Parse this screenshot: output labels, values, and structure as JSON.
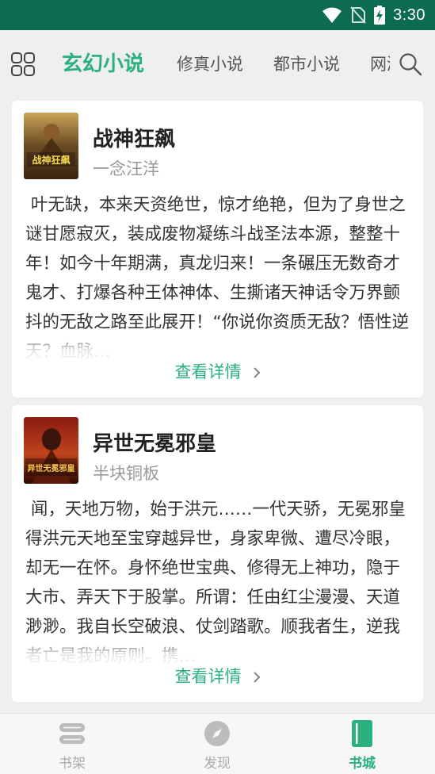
{
  "status": {
    "time": "3:30"
  },
  "nav": {
    "tabs": [
      {
        "label": "玄幻小说",
        "active": true
      },
      {
        "label": "修真小说",
        "active": false
      },
      {
        "label": "都市小说",
        "active": false
      },
      {
        "label": "网游小说",
        "active": false
      }
    ],
    "menu_icon": "grid-icon",
    "search_icon": "search-icon"
  },
  "books": [
    {
      "title": "战神狂飙",
      "author": "一念汪洋",
      "cover_text": "战神狂飙",
      "description": "叶无缺，本来天资绝世，惊才绝艳，但为了身世之谜甘愿寂灭，装成废物凝练斗战圣法本源，整整十年！如今十年期满，真龙归来！一条碾压无数奇才鬼才、打爆各种王体神体、生撕诸天神话令万界颤抖的无敌之路至此展开！“你说你资质无敌？悟性逆天？血脉…",
      "detail_label": "查看详情"
    },
    {
      "title": "异世无冕邪皇",
      "author": "半块铜板",
      "cover_text": "异世无冕邪皇",
      "description": "闻，天地万物，始于洪元……一代天骄，无冕邪皇得洪元天地至宝穿越异世，身家卑微、遭尽冷眼，却无一在怀。身怀绝世宝典、修得无上神功，隐于大市、弄天下于股掌。所谓：任由红尘漫漫、天道渺渺。我自长空破浪、仗剑踏歌。顺我者生，逆我者亡是我的原则。携…",
      "detail_label": "查看详情"
    }
  ],
  "bottom_nav": [
    {
      "label": "书架",
      "icon": "bookshelf-icon",
      "active": false
    },
    {
      "label": "发现",
      "icon": "compass-icon",
      "active": false
    },
    {
      "label": "书城",
      "icon": "bookstore-icon",
      "active": true
    }
  ],
  "colors": {
    "accent": "#2bb07f",
    "status_bar": "#0d6b4f",
    "background": "#efefef"
  }
}
